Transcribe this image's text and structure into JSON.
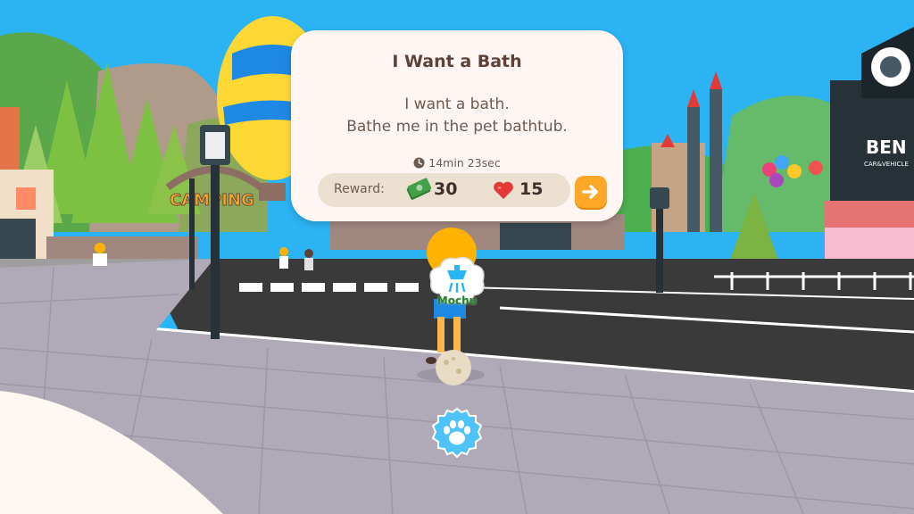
{
  "quest": {
    "title": "I Want a Bath",
    "description": [
      "I want a bath.",
      "Bathe me in the pet bathtub."
    ],
    "timer": "14min 23sec",
    "reward_label": "Reward:",
    "reward_cash": "30",
    "reward_hearts": "15"
  },
  "scene_signs": {
    "camping": "CAMPING",
    "brand": "BEN",
    "brand_sub": "CAR&VEHICLE"
  },
  "pet_name": "Mochu",
  "icons": {
    "timer": "clock-icon",
    "cash": "cash-icon",
    "hearts": "heart-icon",
    "go": "arrow-right-icon",
    "action": "shower-icon",
    "pet": "paw-icon"
  },
  "colors": {
    "card_bg": "#fff6f3",
    "reward_bar": "#ece0d1",
    "go_button": "#ffa726",
    "paw_button": "#4fc3f7",
    "heart": "#e53935",
    "cash": "#43a047"
  }
}
